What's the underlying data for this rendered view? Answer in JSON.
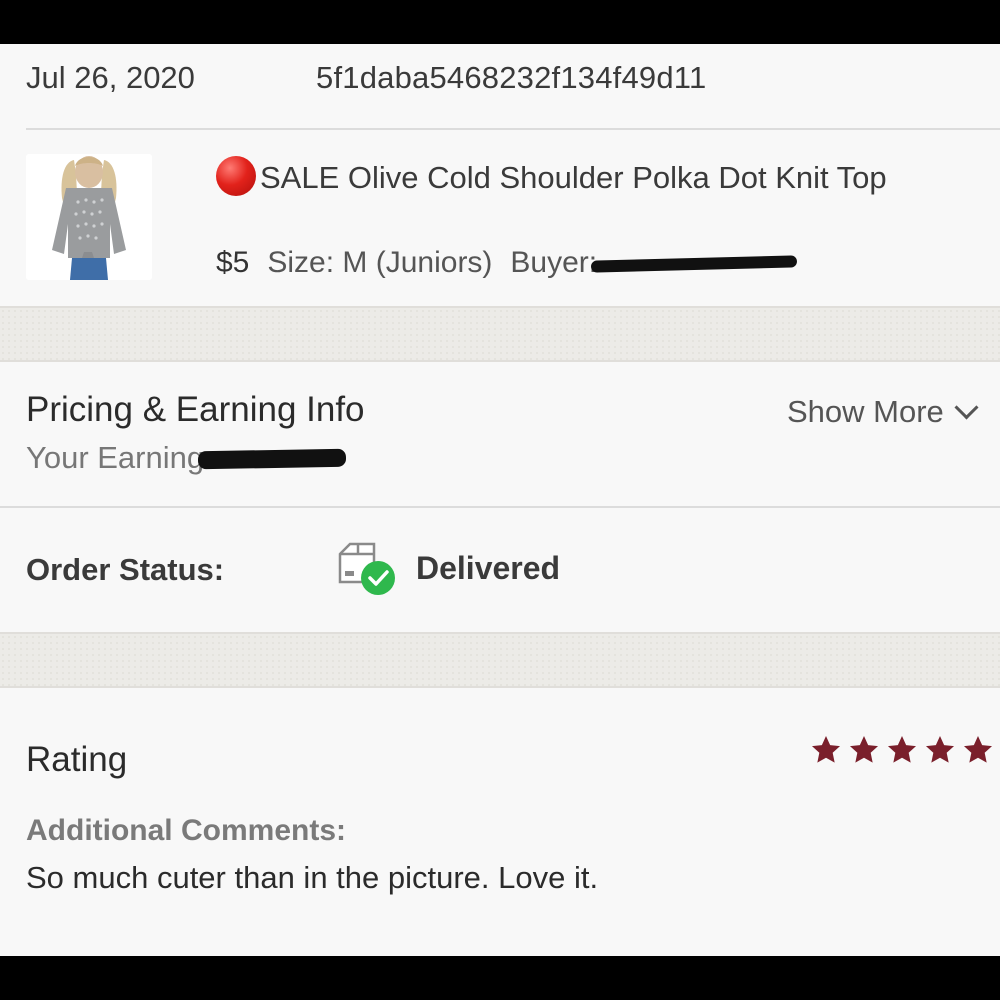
{
  "order": {
    "date": "Jul 26, 2020",
    "id": "5f1daba5468232f134f49d11"
  },
  "product": {
    "title": "SALE Olive Cold Shoulder Polka Dot Knit Top",
    "sale_icon": "red-circle-emoji",
    "price": "$5",
    "size": "Size: M (Juniors)",
    "buyer_label": "Buyer:",
    "thumbnail_icon": "product-photo"
  },
  "pricing": {
    "title": "Pricing & Earning Info",
    "show_more": "Show More",
    "earnings_label": "Your Earning"
  },
  "status": {
    "label": "Order Status:",
    "value": "Delivered",
    "icon": "delivered-box-check-icon",
    "check_color": "#2fb84d"
  },
  "rating": {
    "label": "Rating",
    "stars": 5,
    "max_stars": 5,
    "star_color": "#7a1f2b",
    "comments_label": "Additional Comments:",
    "comments": "So much cuter than in the picture. Love it."
  }
}
